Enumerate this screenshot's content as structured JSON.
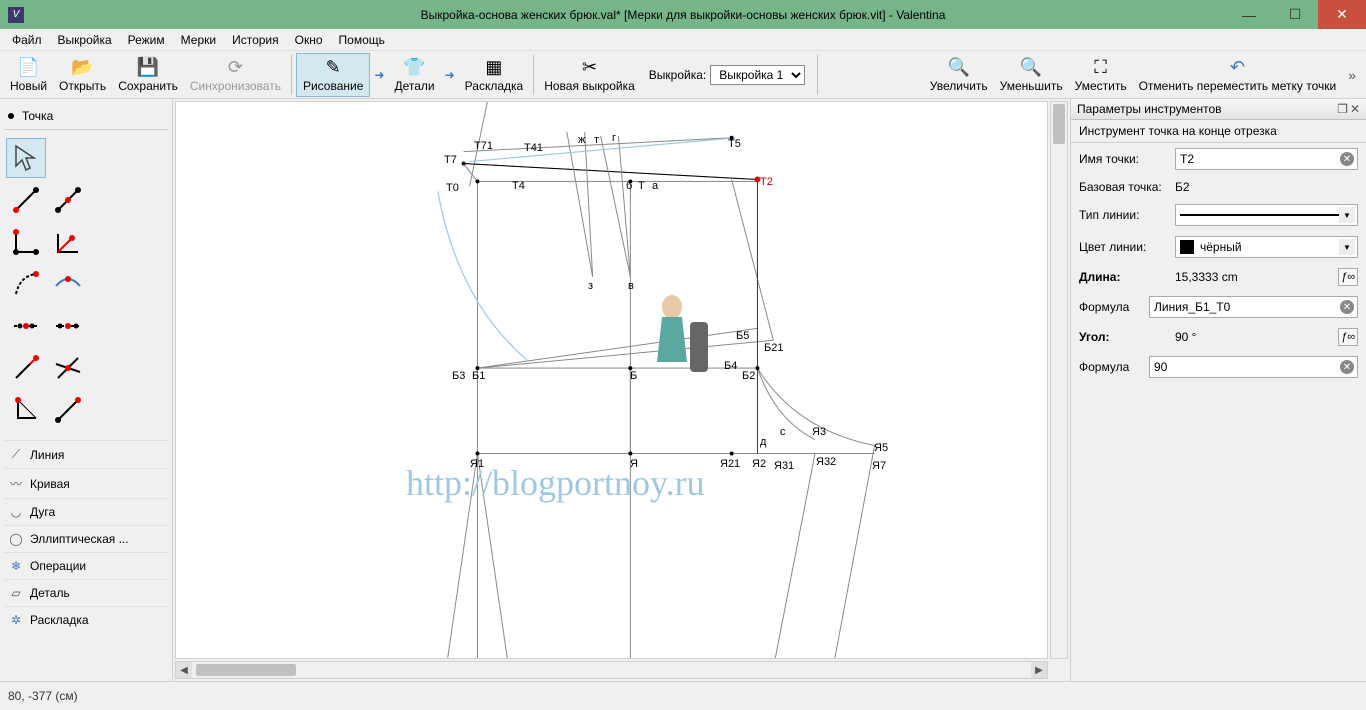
{
  "title": "Выкройка-основа женских брюк.val* [Мерки для выкройки-основы женских брюк.vit] - Valentina",
  "menu": [
    "Файл",
    "Выкройка",
    "Режим",
    "Мерки",
    "История",
    "Окно",
    "Помощь"
  ],
  "toolbar": {
    "new": "Новый",
    "open": "Открыть",
    "save": "Сохранить",
    "sync": "Синхронизовать",
    "draw": "Рисование",
    "details": "Детали",
    "layout": "Раскладка",
    "newpattern": "Новая выкройка",
    "pattern_label": "Выкройка:",
    "pattern_value": "Выкройка 1",
    "zoomin": "Увеличить",
    "zoomout": "Уменьшить",
    "fit": "Уместить",
    "undo_move": "Отменить переместить метку точки"
  },
  "left": {
    "section": "Точка",
    "cats": {
      "line": "Линия",
      "curve": "Кривая",
      "arc": "Дуга",
      "ellipse": "Эллиптическая ...",
      "ops": "Операции",
      "detail": "Деталь",
      "layout": "Раскладка"
    }
  },
  "right": {
    "panel_title": "Параметры инструментов",
    "tool_name": "Инструмент точка на конце отрезка",
    "lbl_point_name": "Имя точки:",
    "point_name": "Т2",
    "lbl_base_point": "Базовая точка:",
    "base_point": "Б2",
    "lbl_line_type": "Тип линии:",
    "lbl_line_color": "Цвет линии:",
    "line_color": "чёрный",
    "lbl_length": "Длина:",
    "length_value": "15,3333 cm",
    "lbl_formula": "Формула",
    "formula_length": "Линия_Б1_Т0",
    "lbl_angle": "Угол:",
    "angle_value": "90 °",
    "formula_angle": "90"
  },
  "points": {
    "T7": "Т7",
    "T71": "Т71",
    "T41": "Т41",
    "zh": "ж",
    "t": "т",
    "g": "г",
    "T5": "Т5",
    "T0": "Т0",
    "T4": "Т4",
    "b": "б",
    "T": "Т",
    "a": "а",
    "T2": "Т2",
    "z": "з",
    "v": "в",
    "B5": "Б5",
    "B21": "Б21",
    "B3": "Б3",
    "B1": "Б1",
    "B": "Б",
    "B4": "Б4",
    "B2": "Б2",
    "d": "д",
    "s": "с",
    "Ya1": "Я1",
    "Ya": "Я",
    "Ya21": "Я21",
    "Ya2": "Я2",
    "Ya31": "Я31",
    "Ya3": "Я3",
    "Ya32": "Я32",
    "Ya5": "Я5",
    "Ya7": "Я7"
  },
  "watermark": "http://blogportnoy.ru",
  "status": "80, -377 (см)"
}
